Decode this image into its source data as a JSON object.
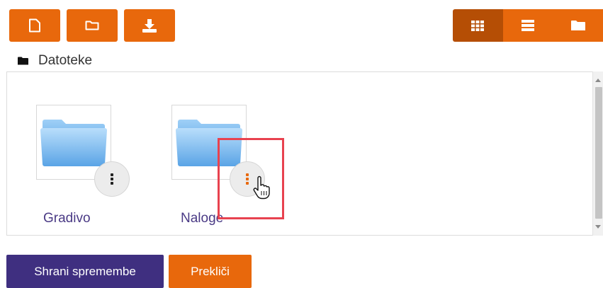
{
  "toolbar": {
    "buttons": [
      {
        "name": "new-file-button",
        "icon": "file-icon"
      },
      {
        "name": "new-folder-button",
        "icon": "folder-icon"
      },
      {
        "name": "download-button",
        "icon": "download-icon"
      }
    ],
    "view_modes": [
      {
        "name": "icons-view",
        "icon": "grid-icon",
        "active": true
      },
      {
        "name": "list-view",
        "icon": "list-icon",
        "active": false
      },
      {
        "name": "tree-view",
        "icon": "folder-solid-icon",
        "active": false
      }
    ]
  },
  "breadcrumb": {
    "icon": "folder-solid-icon",
    "label": "Datoteke"
  },
  "files": [
    {
      "name": "Gradivo",
      "type": "folder",
      "menu_hover": false
    },
    {
      "name": "Naloge",
      "type": "folder",
      "menu_hover": true
    }
  ],
  "actions": {
    "save_label": "Shrani spremembe",
    "cancel_label": "Prekliči"
  },
  "colors": {
    "accent": "#e8680c",
    "accent_active": "#b54e05",
    "primary": "#3f2f80",
    "link": "#4a3a85",
    "highlight": "#e8424f"
  }
}
